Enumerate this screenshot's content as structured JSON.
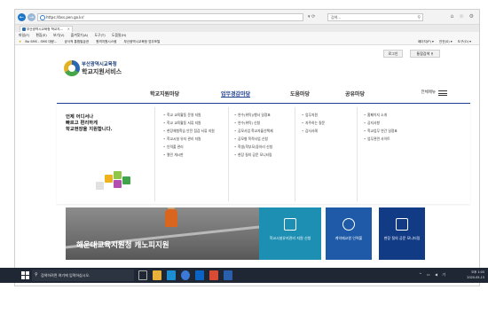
{
  "browser": {
    "address": "https://bss.pen.go.kr/",
    "search_placeholder": "검색...",
    "tab_label": "부산광역시교육청 학교지...",
    "menu": [
      "파일(F)",
      "편집(E)",
      "보기(V)",
      "즐겨찾기(A)",
      "도구(T)",
      "도움말(H)"
    ],
    "favorites": [
      "Bo SMS - SMS 대량...",
      "공식적 통합발급권",
      "원격지원시스템",
      "부산광역시교육청 업무포털"
    ],
    "fav_tools": [
      "페이지(P) ▾",
      "안전(S) ▾",
      "도구(O) ▾"
    ],
    "zoom": "125%"
  },
  "header": {
    "login": "로그인",
    "search": "통합검색 ⚲",
    "org_name": "부산광역시교육청",
    "service_name": "학교지원서비스",
    "all_menu": "전체메뉴"
  },
  "gnb": [
    {
      "label": "학교지원마당",
      "active": false
    },
    {
      "label": "업무경감마당",
      "active": true
    },
    {
      "label": "도움마당",
      "active": false
    },
    {
      "label": "공유마당",
      "active": false
    }
  ],
  "mega": {
    "intro": [
      "언제 어디서나",
      "빠르고 편리하게",
      "학교현장을 지원합니다."
    ],
    "col1": [
      "학교 교육활동 운영 지원",
      "학교 교육활동 서류 지원",
      "현장체험학습 안전 점검 서류 지원",
      "학교시설 유지 관리 지원",
      "인력풀 관리",
      "열린 게시판"
    ],
    "col2": [
      "연수(위탁)/행사 일정표",
      "연수(위탁) 신청",
      "공모사업 학교자율선택제",
      "공모형 목적사업 신청",
      "학생(학부모)동아리 신청",
      "현장 질의 공문 모니터링"
    ],
    "col3": [
      "업무지원",
      "자주하는 질문",
      "감사사례"
    ],
    "col4": [
      "홈페이지 소개",
      "공지사항",
      "학교업무 연간 일정표",
      "업무관련 사이트"
    ]
  },
  "banner": {
    "caption": "해운대교육지원청 캐노피지원"
  },
  "quick": [
    {
      "label": "학교시설유지관리 지원 신청"
    },
    {
      "label": "계약제교원 인력풀"
    },
    {
      "label": "현장 질의 공문 모니터링"
    }
  ],
  "taskbar": {
    "search": "검색하려면 여기에 입력하십시오.",
    "time": "오후 1:05",
    "date": "2020-05-15"
  },
  "colors": {
    "brand": "#1d3f8f",
    "quick1": "#1d8fb3",
    "quick2": "#1e5aa7",
    "quick3": "#123b86"
  }
}
